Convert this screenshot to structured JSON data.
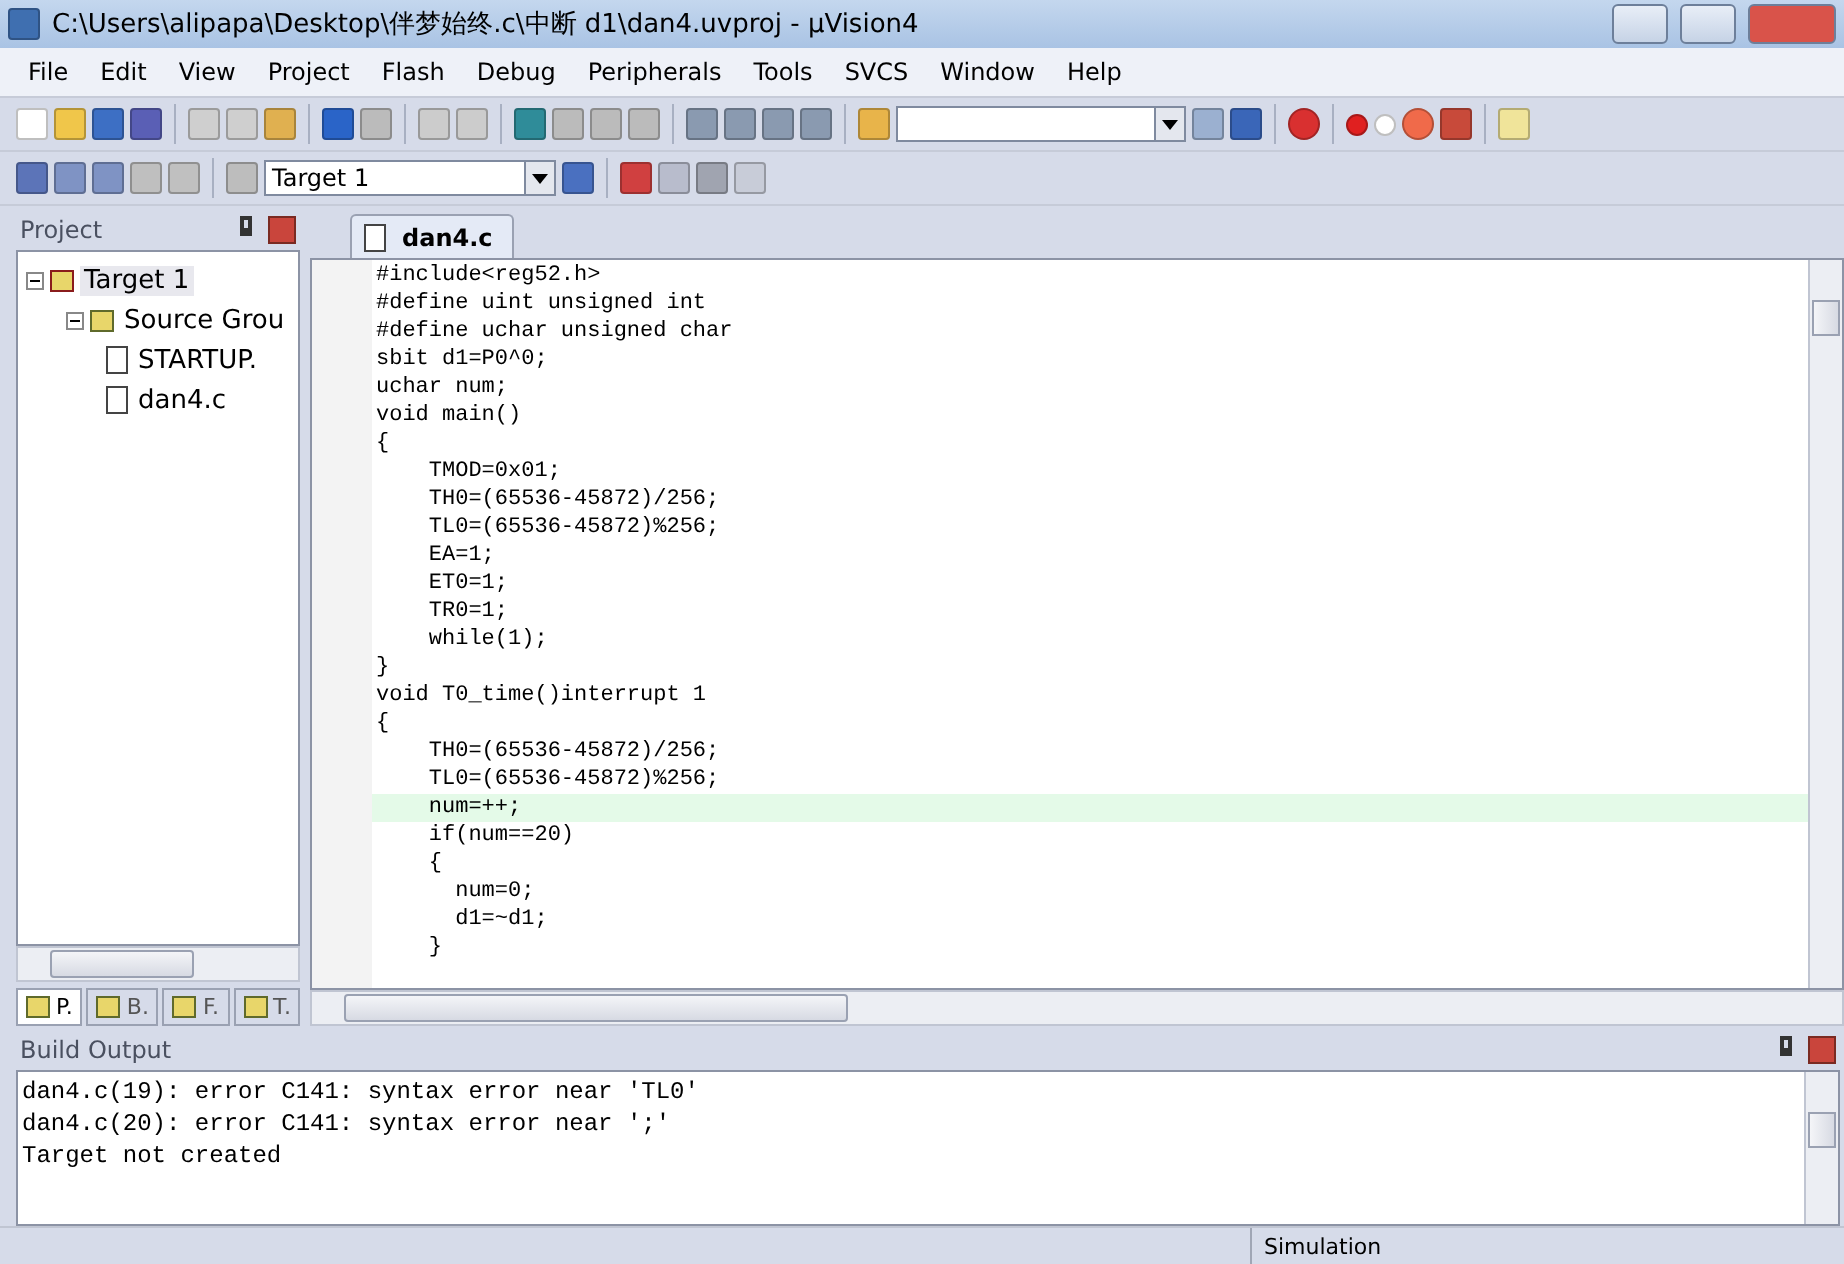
{
  "window": {
    "title": "C:\\Users\\alipapa\\Desktop\\伴梦始终.c\\中断 d1\\dan4.uvproj - µVision4"
  },
  "menu": [
    "File",
    "Edit",
    "View",
    "Project",
    "Flash",
    "Debug",
    "Peripherals",
    "Tools",
    "SVCS",
    "Window",
    "Help"
  ],
  "target_select": {
    "value": "Target 1"
  },
  "project_panel": {
    "title": "Project",
    "tree": [
      {
        "label": "Target 1",
        "kind": "target",
        "selected": true,
        "expanded": true,
        "children": [
          {
            "label": "Source Grou",
            "kind": "group",
            "selected": false,
            "expanded": true,
            "children": [
              {
                "label": "STARTUP.",
                "kind": "file",
                "selected": false
              },
              {
                "label": "dan4.c",
                "kind": "file",
                "selected": false
              }
            ]
          }
        ]
      }
    ],
    "tabs": [
      {
        "label": "P.",
        "selected": true
      },
      {
        "label": "B.",
        "selected": false
      },
      {
        "label": "F.",
        "selected": false
      },
      {
        "label": "T.",
        "selected": false
      }
    ]
  },
  "editor": {
    "tabs": [
      {
        "label": "dan4.c",
        "selected": true
      }
    ],
    "lines": [
      {
        "text": "#include<reg52.h>",
        "current": false
      },
      {
        "text": "#define uint unsigned int",
        "current": false
      },
      {
        "text": "#define uchar unsigned char",
        "current": false
      },
      {
        "text": "sbit d1=P0^0;",
        "current": false
      },
      {
        "text": "uchar num;",
        "current": false
      },
      {
        "text": "void main()",
        "current": false
      },
      {
        "text": "{",
        "current": false
      },
      {
        "text": "    TMOD=0x01;",
        "current": false
      },
      {
        "text": "    TH0=(65536-45872)/256;",
        "current": false
      },
      {
        "text": "    TL0=(65536-45872)%256;",
        "current": false
      },
      {
        "text": "    EA=1;",
        "current": false
      },
      {
        "text": "    ET0=1;",
        "current": false
      },
      {
        "text": "    TR0=1;",
        "current": false
      },
      {
        "text": "    while(1);",
        "current": false
      },
      {
        "text": "}",
        "current": false
      },
      {
        "text": "void T0_time()interrupt 1",
        "current": false
      },
      {
        "text": "{",
        "current": false
      },
      {
        "text": "    TH0=(65536-45872)/256;",
        "current": false
      },
      {
        "text": "    TL0=(65536-45872)%256;",
        "current": false
      },
      {
        "text": "    num=++;",
        "current": true
      },
      {
        "text": "    if(num==20)",
        "current": false
      },
      {
        "text": "    {",
        "current": false
      },
      {
        "text": "      num=0;",
        "current": false
      },
      {
        "text": "      d1=~d1;",
        "current": false
      },
      {
        "text": "    }",
        "current": false
      }
    ]
  },
  "build_output": {
    "title": "Build Output",
    "lines": [
      "dan4.c(19): error C141: syntax error near 'TL0'",
      "dan4.c(20): error C141: syntax error near ';'",
      "Target not created"
    ]
  },
  "status_bar": {
    "mode": "Simulation"
  }
}
